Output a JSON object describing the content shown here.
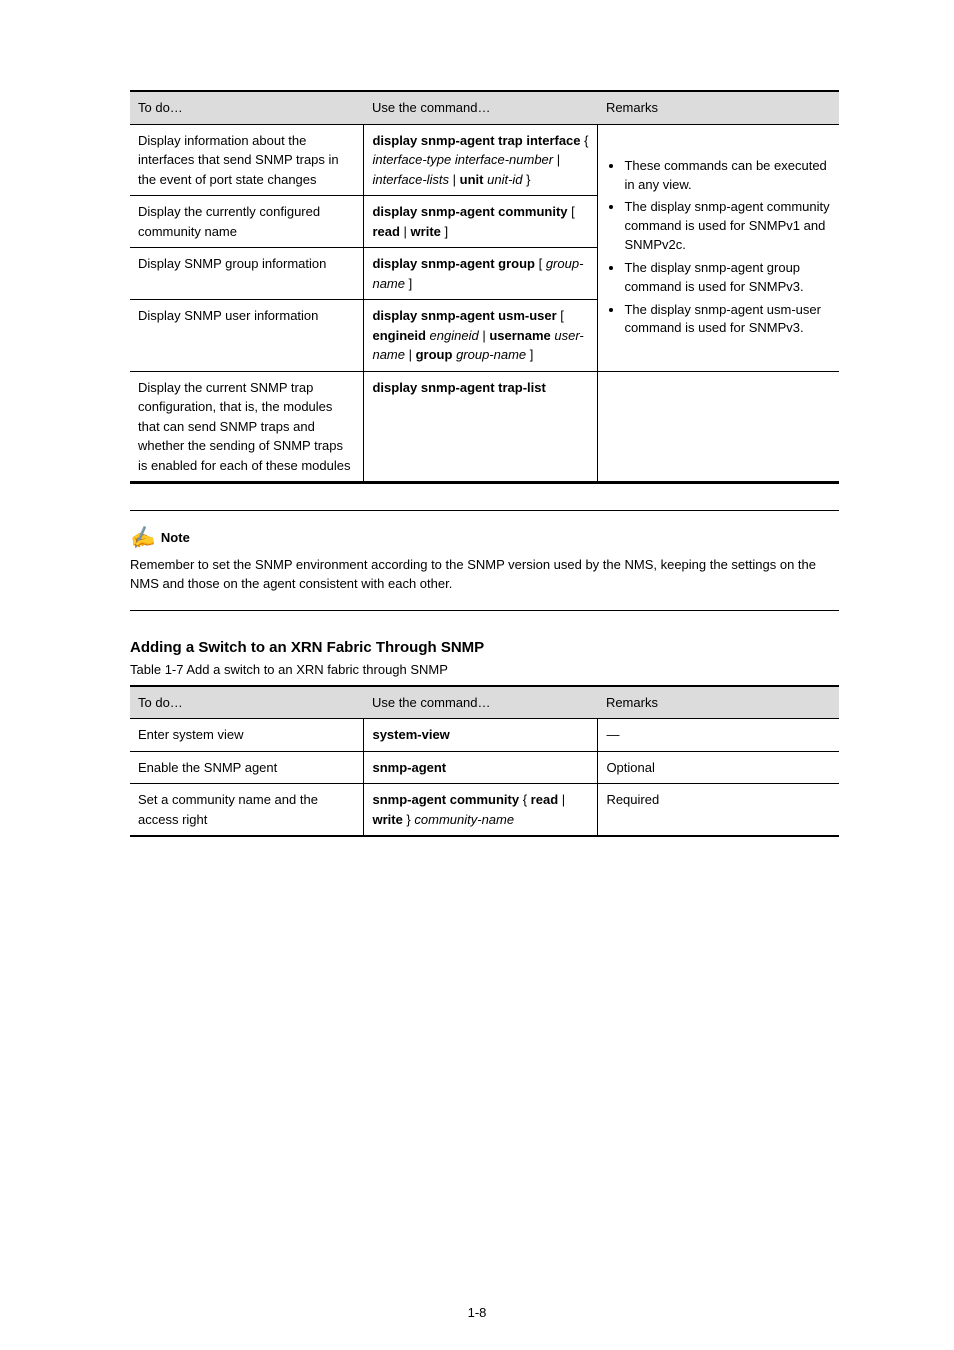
{
  "table1": {
    "headers": [
      "To do…",
      "Use the command…",
      "Remarks"
    ],
    "rows": [
      {
        "todo": "Display information about the interfaces that send SNMP traps in the event of port state changes",
        "cmd_parts": [
          {
            "t": "display snmp-agent trap interface",
            "b": true
          },
          {
            "t": " { ",
            "b": false
          },
          {
            "t": "interface-type interface-number",
            "b": false,
            "i": true
          },
          {
            "t": " | ",
            "b": false
          },
          {
            "t": "interface-lists",
            "b": false,
            "i": true
          },
          {
            "t": " | ",
            "b": false
          },
          {
            "t": "unit",
            "b": true
          },
          {
            "t": " ",
            "b": false
          },
          {
            "t": "unit-id",
            "b": false,
            "i": true
          },
          {
            "t": " }",
            "b": false
          }
        ]
      },
      {
        "todo": "Display the currently configured community name",
        "cmd_parts": [
          {
            "t": "display snmp-agent community",
            "b": true
          },
          {
            "t": " [ ",
            "b": false
          },
          {
            "t": "read",
            "b": true
          },
          {
            "t": " | ",
            "b": false
          },
          {
            "t": "write",
            "b": true
          },
          {
            "t": " ]",
            "b": false
          }
        ]
      },
      {
        "todo": "Display SNMP group information",
        "cmd_parts": [
          {
            "t": "display snmp-agent group",
            "b": true
          },
          {
            "t": " [ ",
            "b": false
          },
          {
            "t": "group-name",
            "b": false,
            "i": true
          },
          {
            "t": " ]",
            "b": false
          }
        ]
      },
      {
        "todo": "Display SNMP user information",
        "cmd_parts": [
          {
            "t": "display snmp-agent usm-user",
            "b": true
          },
          {
            "t": " [ ",
            "b": false
          },
          {
            "t": "engineid",
            "b": true
          },
          {
            "t": " ",
            "b": false
          },
          {
            "t": "engineid",
            "b": false,
            "i": true
          },
          {
            "t": " | ",
            "b": false
          },
          {
            "t": "username",
            "b": true
          },
          {
            "t": " ",
            "b": false
          },
          {
            "t": "user-name",
            "b": false,
            "i": true
          },
          {
            "t": " | ",
            "b": false
          },
          {
            "t": "group",
            "b": true
          },
          {
            "t": " ",
            "b": false
          },
          {
            "t": "group-name",
            "b": false,
            "i": true
          },
          {
            "t": " ]",
            "b": false
          }
        ]
      },
      {
        "todo": "Display the current SNMP trap configuration, that is, the modules that can send SNMP traps and whether the sending of SNMP traps is enabled for each of these modules",
        "cmd_parts": [
          {
            "t": "display snmp-agent trap-list",
            "b": true
          }
        ]
      }
    ],
    "merged_remarks": [
      "These commands can be executed in any view.",
      "The display snmp-agent community command is used for SNMPv1 and SNMPv2c.",
      "The display snmp-agent group command is used for SNMPv3.",
      "The display snmp-agent usm-user command is used for SNMPv3."
    ]
  },
  "note": {
    "label": "Note",
    "text": "Remember to set the SNMP environment according to the SNMP version used by the NMS, keeping the settings on the NMS and those on the agent consistent with each other."
  },
  "section": {
    "title": "Adding a Switch to an XRN Fabric Through SNMP",
    "caption": "Table 1-7 Add a switch to an XRN fabric through SNMP"
  },
  "table2": {
    "headers": [
      "To do…",
      "Use the command…",
      "Remarks"
    ],
    "rows": [
      {
        "todo": "Enter system view",
        "cmd": [
          {
            "t": "system-view",
            "b": true
          }
        ],
        "remarks": "—"
      },
      {
        "todo": "Enable the SNMP agent",
        "cmd": [
          {
            "t": "snmp-agent",
            "b": true
          }
        ],
        "remarks": "Optional"
      },
      {
        "todo": "Set a community name and the access right",
        "cmd": [
          {
            "t": "snmp-agent community",
            "b": true
          },
          {
            "t": " { ",
            "b": false
          },
          {
            "t": "read",
            "b": true
          },
          {
            "t": " | ",
            "b": false
          },
          {
            "t": "write",
            "b": true
          },
          {
            "t": " } ",
            "b": false
          },
          {
            "t": "community-name",
            "b": false,
            "i": true
          }
        ],
        "remarks": "Required"
      }
    ]
  },
  "page_number": "1-8"
}
